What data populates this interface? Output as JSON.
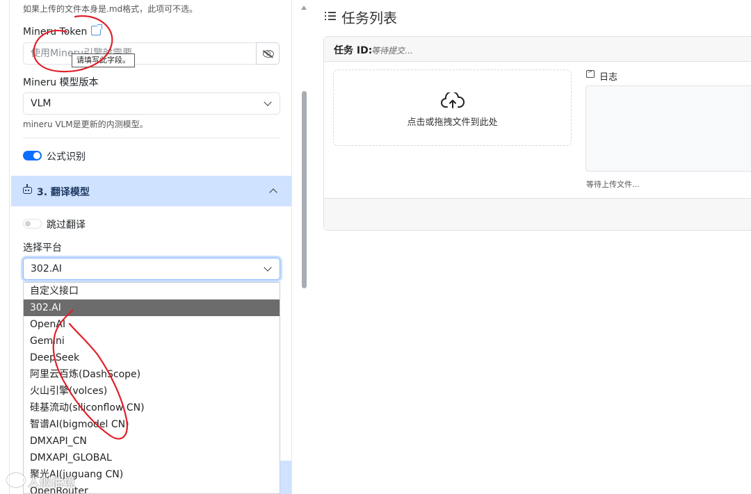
{
  "left": {
    "hint_top": "如果上传的文件本身是.md格式，此项可不选。",
    "mineru_token": {
      "label": "Mineru Token",
      "placeholder": "使用Mineru引擎时需要",
      "tooltip": "请填写此字段。"
    },
    "mineru_model": {
      "label": "Mineru 模型版本",
      "value": "VLM",
      "description": "mineru VLM是更新的内测模型。"
    },
    "formula_toggle": {
      "label": "公式识别",
      "checked": true
    },
    "section3": {
      "title": "3.  翻译模型"
    },
    "skip_toggle": {
      "label": "跳过翻译",
      "checked": false
    },
    "platform": {
      "label": "选择平台",
      "value": "302.AI",
      "options": [
        "自定义接口",
        "302.AI",
        "OpenAI",
        "Gemini",
        "DeepSeek",
        "阿里云百炼(DashScope)",
        "火山引擎(volces)",
        "硅基流动(siliconflow CN)",
        "智谱AI(bigmodel CN)",
        "DMXAPI_CN",
        "DMXAPI_GLOBAL",
        "聚光AI(juguang CN)",
        "OpenRouter"
      ],
      "selected_index": 1
    }
  },
  "right": {
    "title": "任务列表",
    "task_id_label": "任务 ID:",
    "task_id_value": "等待提交...",
    "drop_text": "点击或拖拽文件到此处",
    "log_label": "日志",
    "log_status": "等待上传文件..."
  },
  "watermark": "人似估境",
  "colors": {
    "accent": "#0d6efd",
    "section_bg": "#cfe2ff",
    "annotation_red": "#e0202a",
    "selected_option_bg": "#6c6c6c"
  }
}
